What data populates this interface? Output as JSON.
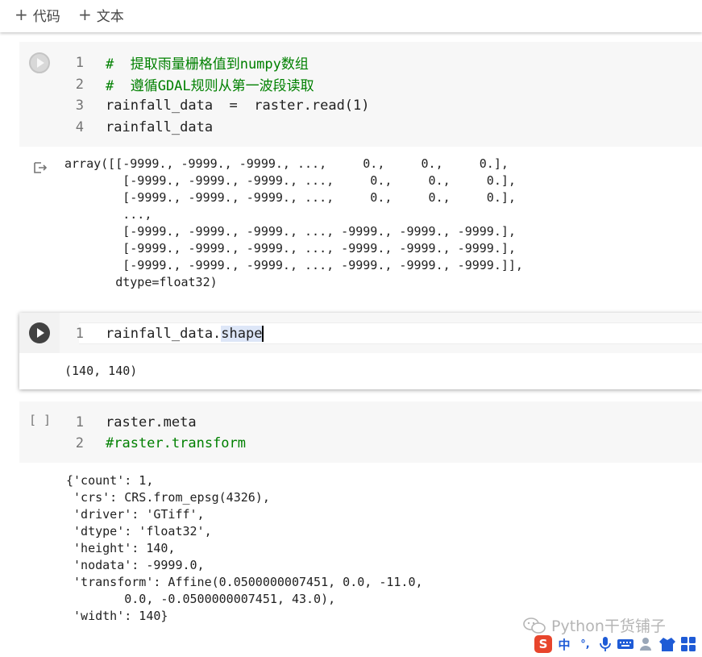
{
  "toolbar": {
    "add_code_label": "代码",
    "add_text_label": "文本"
  },
  "cells": [
    {
      "lines": [
        {
          "n": "1",
          "text": "#  提取雨量栅格值到numpy数组"
        },
        {
          "n": "2",
          "text": "#  遵循GDAL规则从第一波段读取"
        },
        {
          "n": "3",
          "text": "rainfall_data  =  raster.read(1)"
        },
        {
          "n": "4",
          "text": "rainfall_data"
        }
      ],
      "output": "array([[-9999., -9999., -9999., ...,     0.,     0.,     0.],\n        [-9999., -9999., -9999., ...,     0.,     0.,     0.],\n        [-9999., -9999., -9999., ...,     0.,     0.,     0.],\n        ...,\n        [-9999., -9999., -9999., ..., -9999., -9999., -9999.],\n        [-9999., -9999., -9999., ..., -9999., -9999., -9999.],\n        [-9999., -9999., -9999., ..., -9999., -9999., -9999.]],\n       dtype=float32)"
    },
    {
      "lines": [
        {
          "n": "1",
          "text_pre": "rainfall_data.",
          "text_sel": "shape"
        }
      ],
      "output": "(140, 140)"
    },
    {
      "execution_count": "[ ]",
      "lines": [
        {
          "n": "1",
          "text": "raster.meta"
        },
        {
          "n": "2",
          "text": "#raster.transform"
        }
      ],
      "output": "{'count': 1,\n 'crs': CRS.from_epsg(4326),\n 'driver': 'GTiff',\n 'dtype': 'float32',\n 'height': 140,\n 'nodata': -9999.0,\n 'transform': Affine(0.0500000007451, 0.0, -11.0,\n        0.0, -0.0500000007451, 43.0),\n 'width': 140}"
    }
  ],
  "watermark": "Python干货铺子",
  "ime": {
    "logo": "S",
    "mode": "中",
    "punct": "°,"
  },
  "colors": {
    "run_active": "#424242",
    "run_idle": "#cfcfcf",
    "comment": "#008000",
    "ime_red": "#e8452c",
    "ime_blue": "#1e5bd6"
  }
}
